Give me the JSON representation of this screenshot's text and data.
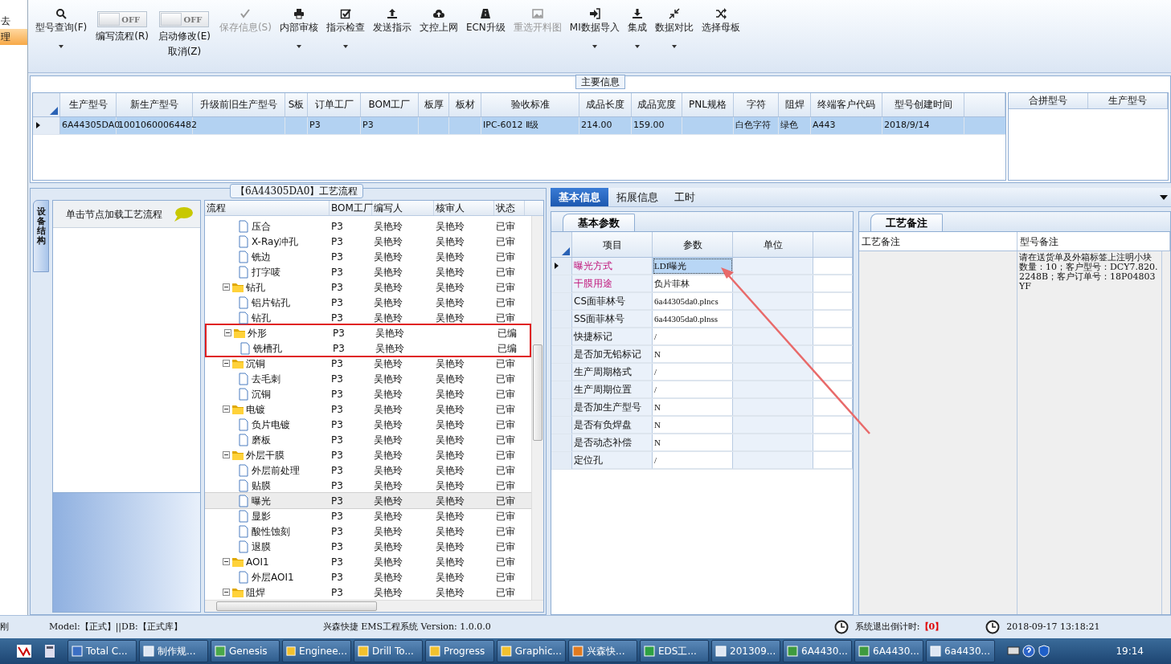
{
  "left_strip": {
    "items": [
      {
        "label": "去",
        "selected": false
      },
      {
        "label": "理",
        "selected": true
      }
    ]
  },
  "toolbar": {
    "items": [
      {
        "kind": "button",
        "label": "型号查询(F)",
        "disabled": false,
        "dropdown": true
      },
      {
        "kind": "toggle",
        "state_text": "OFF",
        "on": false,
        "label": "编写流程(R)"
      },
      {
        "kind": "toggle",
        "state_text": "OFF",
        "on": false,
        "label": "启动修改(E)",
        "label_2": "取消(Z)"
      },
      {
        "kind": "button",
        "label": "保存信息(S)",
        "disabled": true,
        "dropdown": false
      },
      {
        "kind": "button",
        "label": "内部审核",
        "disabled": false,
        "dropdown": true
      },
      {
        "kind": "button",
        "label": "指示检查",
        "disabled": false,
        "dropdown": true
      },
      {
        "kind": "button",
        "label": "发送指示",
        "disabled": false,
        "dropdown": false
      },
      {
        "kind": "button",
        "label": "文控上网",
        "disabled": false,
        "dropdown": false
      },
      {
        "kind": "button",
        "label": "ECN升级",
        "disabled": false,
        "dropdown": false
      },
      {
        "kind": "button",
        "label": "重选开料图",
        "disabled": true,
        "dropdown": false
      },
      {
        "kind": "button",
        "label": "MI数据导入",
        "disabled": false,
        "dropdown": true
      },
      {
        "kind": "button",
        "label": "集成",
        "disabled": false,
        "dropdown": true
      },
      {
        "kind": "button",
        "label": "数据对比",
        "disabled": false,
        "dropdown": true
      },
      {
        "kind": "button",
        "label": "选择母板",
        "disabled": false,
        "dropdown": false
      }
    ]
  },
  "main_info": {
    "title": "主要信息",
    "columns": [
      "生产型号",
      "新生产型号",
      "升级前旧生产型号",
      "S板",
      "订单工厂",
      "BOM工厂",
      "板厚",
      "板材",
      "验收标准",
      "成品长度",
      "成品宽度",
      "PNL规格",
      "字符",
      "阻焊",
      "终端客户代码",
      "型号创建时间"
    ],
    "rows": [
      {
        "selected": true,
        "cells": [
          "6A44305DA0",
          "10010600064482",
          null,
          null,
          "P3",
          "P3",
          null,
          null,
          "IPC-6012 Ⅱ级",
          "214.00",
          "159.00",
          null,
          "白色字符",
          "绿色",
          "A443",
          "2018/9/14"
        ]
      }
    ],
    "side_columns": [
      "合拼型号",
      "生产型号"
    ]
  },
  "process": {
    "title": "【6A44305DA0】工艺流程",
    "side_tab": "设备结构",
    "hint": "单击节点加载工艺流程",
    "columns": [
      "流程",
      "BOM工厂",
      "编写人",
      "核审人",
      "状态"
    ],
    "tree": [
      {
        "kind": "file",
        "label": "压合",
        "bom": "P3",
        "writer": "吴艳玲",
        "reviewer": "吴艳玲",
        "status": "已审",
        "selected": false
      },
      {
        "kind": "file",
        "label": "X-Ray冲孔",
        "bom": "P3",
        "writer": "吴艳玲",
        "reviewer": "吴艳玲",
        "status": "已审",
        "selected": false
      },
      {
        "kind": "file",
        "label": "铣边",
        "bom": "P3",
        "writer": "吴艳玲",
        "reviewer": "吴艳玲",
        "status": "已审",
        "selected": false
      },
      {
        "kind": "file",
        "label": "打字唛",
        "bom": "P3",
        "writer": "吴艳玲",
        "reviewer": "吴艳玲",
        "status": "已审",
        "selected": false
      },
      {
        "kind": "folder",
        "label": "钻孔",
        "bom": "P3",
        "writer": "吴艳玲",
        "reviewer": "吴艳玲",
        "status": "已审",
        "selected": false,
        "expanded": true,
        "marked": false,
        "children": [
          {
            "kind": "file",
            "label": "铝片钻孔",
            "bom": "P3",
            "writer": "吴艳玲",
            "reviewer": "吴艳玲",
            "status": "已审",
            "selected": false
          },
          {
            "kind": "file",
            "label": "钻孔",
            "bom": "P3",
            "writer": "吴艳玲",
            "reviewer": "吴艳玲",
            "status": "已审",
            "selected": false
          }
        ]
      },
      {
        "kind": "folder",
        "label": "外形",
        "bom": "P3",
        "writer": "吴艳玲",
        "status": "已编",
        "selected": false,
        "expanded": true,
        "marked": true,
        "children": [
          {
            "kind": "file",
            "label": "铣槽孔",
            "bom": "P3",
            "writer": "吴艳玲",
            "status": "已编",
            "selected": false
          }
        ]
      },
      {
        "kind": "folder",
        "label": "沉铜",
        "bom": "P3",
        "writer": "吴艳玲",
        "reviewer": "吴艳玲",
        "status": "已审",
        "selected": false,
        "expanded": true,
        "marked": false,
        "children": [
          {
            "kind": "file",
            "label": "去毛刺",
            "bom": "P3",
            "writer": "吴艳玲",
            "reviewer": "吴艳玲",
            "status": "已审",
            "selected": false
          },
          {
            "kind": "file",
            "label": "沉铜",
            "bom": "P3",
            "writer": "吴艳玲",
            "reviewer": "吴艳玲",
            "status": "已审",
            "selected": false
          }
        ]
      },
      {
        "kind": "folder",
        "label": "电镀",
        "bom": "P3",
        "writer": "吴艳玲",
        "reviewer": "吴艳玲",
        "status": "已审",
        "selected": false,
        "expanded": true,
        "marked": false,
        "children": [
          {
            "kind": "file",
            "label": "负片电镀",
            "bom": "P3",
            "writer": "吴艳玲",
            "reviewer": "吴艳玲",
            "status": "已审",
            "selected": false
          },
          {
            "kind": "file",
            "label": "磨板",
            "bom": "P3",
            "writer": "吴艳玲",
            "reviewer": "吴艳玲",
            "status": "已审",
            "selected": false
          }
        ]
      },
      {
        "kind": "folder",
        "label": "外层干膜",
        "bom": "P3",
        "writer": "吴艳玲",
        "reviewer": "吴艳玲",
        "status": "已审",
        "selected": false,
        "expanded": true,
        "marked": false,
        "children": [
          {
            "kind": "file",
            "label": "外层前处理",
            "bom": "P3",
            "writer": "吴艳玲",
            "reviewer": "吴艳玲",
            "status": "已审",
            "selected": false
          },
          {
            "kind": "file",
            "label": "贴膜",
            "bom": "P3",
            "writer": "吴艳玲",
            "reviewer": "吴艳玲",
            "status": "已审",
            "selected": false
          },
          {
            "kind": "file",
            "label": "曝光",
            "bom": "P3",
            "writer": "吴艳玲",
            "reviewer": "吴艳玲",
            "status": "已审",
            "selected": true
          },
          {
            "kind": "file",
            "label": "显影",
            "bom": "P3",
            "writer": "吴艳玲",
            "reviewer": "吴艳玲",
            "status": "已审",
            "selected": false
          },
          {
            "kind": "file",
            "label": "酸性蚀刻",
            "bom": "P3",
            "writer": "吴艳玲",
            "reviewer": "吴艳玲",
            "status": "已审",
            "selected": false
          },
          {
            "kind": "file",
            "label": "退膜",
            "bom": "P3",
            "writer": "吴艳玲",
            "reviewer": "吴艳玲",
            "status": "已审",
            "selected": false
          }
        ]
      },
      {
        "kind": "folder",
        "label": "AOI1",
        "bom": "P3",
        "writer": "吴艳玲",
        "reviewer": "吴艳玲",
        "status": "已审",
        "selected": false,
        "expanded": true,
        "marked": false,
        "children": [
          {
            "kind": "file",
            "label": "外层AOI1",
            "bom": "P3",
            "writer": "吴艳玲",
            "reviewer": "吴艳玲",
            "status": "已审",
            "selected": false
          }
        ]
      },
      {
        "kind": "folder",
        "label": "阻焊",
        "bom": "P3",
        "writer": "吴艳玲",
        "reviewer": "吴艳玲",
        "status": "已审",
        "selected": false,
        "expanded": true,
        "marked": false
      }
    ]
  },
  "detail": {
    "tabs": [
      {
        "label": "基本信息",
        "selected": true
      },
      {
        "label": "拓展信息",
        "selected": false
      },
      {
        "label": "工时",
        "selected": false
      }
    ],
    "params_tab": "基本参数",
    "params_columns": [
      "项目",
      "参数",
      "单位"
    ],
    "params": [
      {
        "item": "曝光方式",
        "value": "LDI曝光",
        "emphasis": true,
        "selected": true
      },
      {
        "item": "干膜用途",
        "value": "负片菲林",
        "emphasis": true,
        "selected": false
      },
      {
        "item": "CS面菲林号",
        "value": "6a44305da0.plncs",
        "emphasis": false,
        "selected": false
      },
      {
        "item": "SS面菲林号",
        "value": "6a44305da0.plnss",
        "emphasis": false,
        "selected": false
      },
      {
        "item": "快捷标记",
        "value": "/",
        "emphasis": false,
        "selected": false
      },
      {
        "item": "是否加无铅标记",
        "value": "N",
        "emphasis": false,
        "selected": false
      },
      {
        "item": "生产周期格式",
        "value": "/",
        "emphasis": false,
        "selected": false
      },
      {
        "item": "生产周期位置",
        "value": "/",
        "emphasis": false,
        "selected": false
      },
      {
        "item": "是否加生产型号",
        "value": "N",
        "emphasis": false,
        "selected": false
      },
      {
        "item": "是否有负焊盘",
        "value": "N",
        "emphasis": false,
        "selected": false
      },
      {
        "item": "是否动态补偿",
        "value": "N",
        "emphasis": false,
        "selected": false
      },
      {
        "item": "定位孔",
        "value": "/",
        "emphasis": false,
        "selected": false
      }
    ],
    "notes_tab": "工艺备注",
    "notes_columns": [
      "工艺备注",
      "型号备注"
    ],
    "model_note": "请在送货单及外箱标签上注明小块数量：10；客户型号：DCY7.820.2248B；客户订单号：18P04803YF"
  },
  "status_bar": {
    "left": "刚",
    "model": "Model:【正式】||DB:【正式库】",
    "app": "兴森快捷 EMS工程系统 Version: 1.0.0.0",
    "countdown_label": "系统退出倒计时:",
    "countdown": "【0】",
    "datetime": "2018-09-17 13:18:21"
  },
  "taskbar": {
    "items": [
      "Total C...",
      "制作规...",
      "Genesis",
      "Enginee...",
      "Drill To...",
      "Progress",
      "Graphic...",
      "兴森快...",
      "EDS工...",
      "201309...",
      "6A4430...",
      "6A4430...",
      "6a4430..."
    ],
    "clock": "19:14"
  }
}
